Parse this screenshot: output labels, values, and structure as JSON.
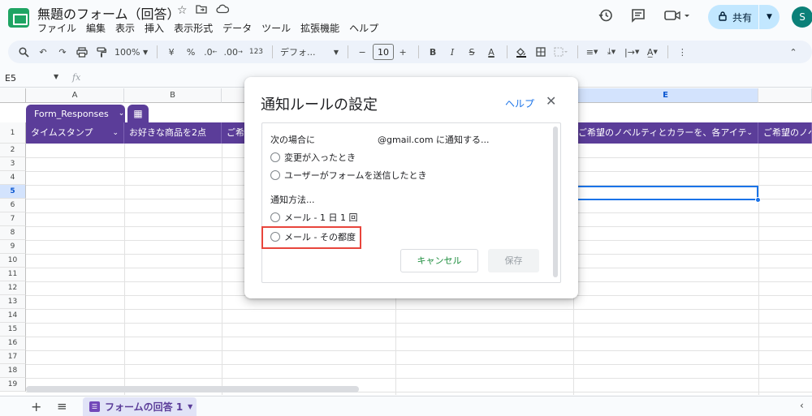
{
  "app": {
    "doc_title": "無題のフォーム（回答）",
    "title_icons": [
      "star-icon",
      "move-to-folder-icon",
      "cloud-saved-icon"
    ]
  },
  "menu": [
    "ファイル",
    "編集",
    "表示",
    "挿入",
    "表示形式",
    "データ",
    "ツール",
    "拡張機能",
    "ヘルプ"
  ],
  "header_right": {
    "icons": [
      "history-icon",
      "comment-icon",
      "meet-icon"
    ],
    "share_label": "共有",
    "avatar_initial": "S"
  },
  "toolbar": {
    "zoom": "100%",
    "currency": "¥",
    "percent": "%",
    "decimal_decrease": ".0",
    "decimal_increase": ".00",
    "number_format": "123",
    "font": "デフォ...",
    "font_size": "10"
  },
  "formula_bar": {
    "cell_ref": "E5",
    "fx": "fx"
  },
  "grid": {
    "columns": [
      "A",
      "B",
      "",
      "",
      "",
      "E",
      ""
    ],
    "selected_column": "E",
    "table_name": "Form_Responses",
    "headers": [
      "タイムスタンプ",
      "お好きな商品を2点",
      "ご希",
      "",
      "",
      "ご希望のノベルティとカラーを、各アイテ",
      "ご希望のノベ"
    ],
    "rows": [
      "1",
      "2",
      "3",
      "4",
      "5",
      "6",
      "7",
      "8",
      "9",
      "10",
      "11",
      "12",
      "13",
      "14",
      "15",
      "16",
      "17",
      "18",
      "19"
    ],
    "selected_row": "5"
  },
  "sheets": {
    "active_tab": "フォームの回答 1"
  },
  "dialog": {
    "title": "通知ルールの設定",
    "help": "ヘルプ",
    "when_label": "次の場合に",
    "notify_label": "@gmail.com に通知する...",
    "trigger_options": [
      "変更が入ったとき",
      "ユーザーがフォームを送信したとき"
    ],
    "method_label": "通知方法...",
    "method_options": [
      "メール - 1 日 1 回",
      "メール - その都度"
    ],
    "cancel": "キャンセル",
    "save": "保存"
  },
  "colors": {
    "table_header": "#5b3d99",
    "accent_blue": "#1a73e8",
    "highlight_red": "#e8453c",
    "cancel_green": "#1e8e3e"
  }
}
